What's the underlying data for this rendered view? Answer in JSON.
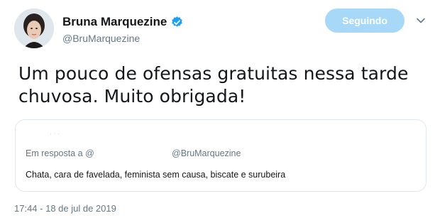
{
  "author": {
    "display_name": "Bruna Marquezine",
    "handle": "@BruMarquezine",
    "verified_color": "#1da1f2"
  },
  "follow_button": {
    "label": "Seguindo",
    "color": "#a7d8f7"
  },
  "tweet": {
    "text_line1": "Um pouco de ofensas gratuitas nessa tarde",
    "text_line2": "chuvosa. Muito obrigada!"
  },
  "quote": {
    "reply_prefix": "Em resposta a @",
    "reply_mention": "@BruMarquezine",
    "text": "Chata, cara de favelada, feminista sem causa, biscate e surubeira"
  },
  "timestamp": "17:44 - 18 de jul de 2019"
}
